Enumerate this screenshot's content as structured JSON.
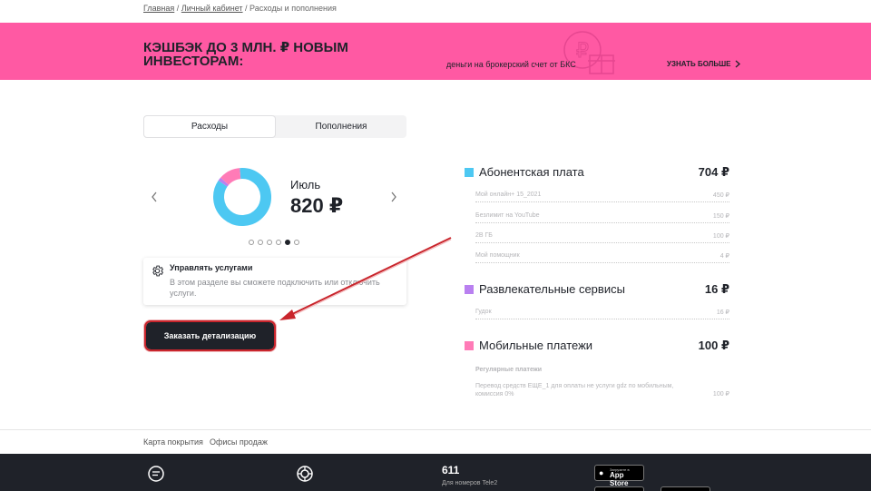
{
  "breadcrumb": {
    "home": "Главная",
    "cabinet": "Личный кабинет",
    "current": "/ Расходы и пополнения",
    "sep": "/"
  },
  "banner": {
    "title": "КЭШБЭК ДО 3 МЛН. ₽ НОВЫМ ИНВЕСТОРАМ:",
    "subtitle": "деньги на брокерский счет от БКС",
    "more": "УЗНАТЬ БОЛЬШЕ"
  },
  "tabs": [
    {
      "label": "Расходы",
      "active": true
    },
    {
      "label": "Пополнения",
      "active": false
    }
  ],
  "summary": {
    "month": "Июль",
    "total": "820 ₽",
    "pages": 6,
    "active_page": 4,
    "segments": [
      {
        "value": 704,
        "color": "#4dc8f2"
      },
      {
        "value": 16,
        "color": "#b980f0"
      },
      {
        "value": 100,
        "color": "#ff7bb7"
      }
    ]
  },
  "service": {
    "title": "Управлять услугами",
    "description": "В этом разделе вы сможете подключить или отключить услуги."
  },
  "order_button": "Заказать детализацию",
  "expenses": [
    {
      "name": "Абонентская плата",
      "amount": "704 ₽",
      "color": "#4dc8f2",
      "rows": [
        {
          "name": "Мой онлайн+ 15_2021",
          "amount": "450 ₽"
        },
        {
          "name": "Безлимит на YouTube",
          "amount": "150 ₽"
        },
        {
          "name": "2В ГБ",
          "amount": "100 ₽"
        },
        {
          "name": "Мой помощник",
          "amount": "4 ₽"
        }
      ]
    },
    {
      "name": "Развлекательные сервисы",
      "amount": "16 ₽",
      "color": "#b980f0",
      "rows": [
        {
          "name": "Гудок",
          "amount": "16 ₽"
        }
      ]
    },
    {
      "name": "Мобильные платежи",
      "amount": "100 ₽",
      "color": "#ff7bb7",
      "sub": "Регулярные платежи",
      "note": "Перевод средств ЕЩЕ_1 для оплаты не услуги gdz по мобильным, комиссия 0%",
      "note_amount": "100 ₽"
    }
  ],
  "footer": {
    "links": [
      "Карта покрытия",
      "Офисы продаж"
    ],
    "phone": "611",
    "phone_sub": "Для номеров Tele2",
    "appstore_small": "Загрузите в",
    "appstore_big": "App Store"
  }
}
